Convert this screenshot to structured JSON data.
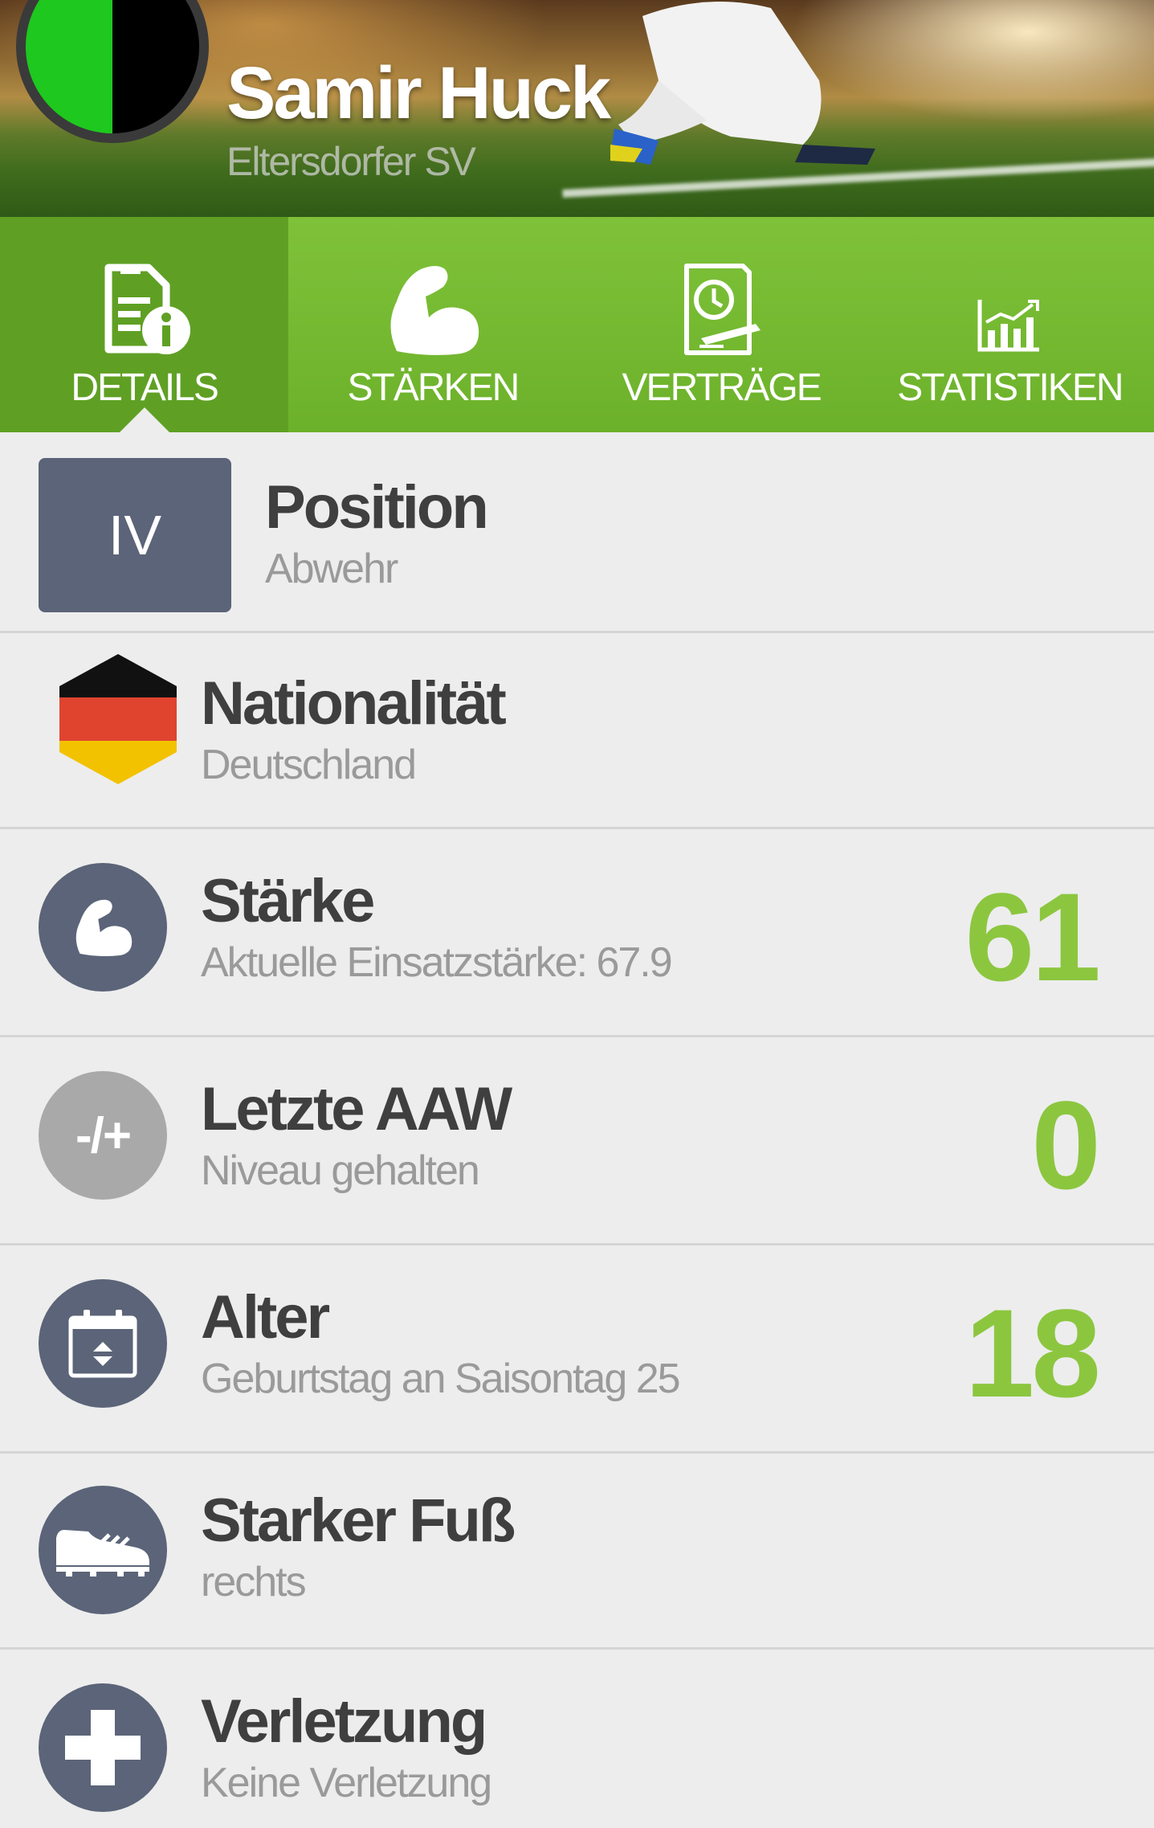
{
  "header": {
    "player_name": "Samir Huck",
    "club_name": "Eltersdorfer SV",
    "club_colors": [
      "#1ec81e",
      "#000000"
    ]
  },
  "tabs": [
    {
      "label": "DETAILS",
      "icon": "details-document-info-icon",
      "active": true
    },
    {
      "label": "STÄRKEN",
      "icon": "flexed-arm-icon",
      "active": false
    },
    {
      "label": "VERTRÄGE",
      "icon": "contract-clock-icon",
      "active": false
    },
    {
      "label": "STATISTIKEN",
      "icon": "bar-chart-icon",
      "active": false
    }
  ],
  "details": {
    "position": {
      "badge": "IV",
      "title": "Position",
      "subtitle": "Abwehr"
    },
    "nationality": {
      "title": "Nationalität",
      "subtitle": "Deutschland",
      "icon": "germany-flag-icon"
    },
    "strength": {
      "title": "Stärke",
      "subtitle": "Aktuelle Einsatzstärke: 67.9",
      "value": "61",
      "icon": "flexed-arm-icon"
    },
    "last_aaw": {
      "badge": "-/+",
      "title": "Letzte AAW",
      "subtitle": "Niveau gehalten",
      "value": "0"
    },
    "age": {
      "title": "Alter",
      "subtitle": "Geburtstag an Saisontag 25",
      "value": "18",
      "icon": "calendar-icon"
    },
    "strong_foot": {
      "title": "Starker Fuß",
      "subtitle": "rechts",
      "icon": "football-boot-icon"
    },
    "injury": {
      "title": "Verletzung",
      "subtitle": "Keine Verletzung",
      "icon": "medical-cross-icon"
    }
  },
  "colors": {
    "accent_green": "#8cc63f",
    "tab_bar": "#6cb12a",
    "icon_circle": "#5b6478"
  }
}
